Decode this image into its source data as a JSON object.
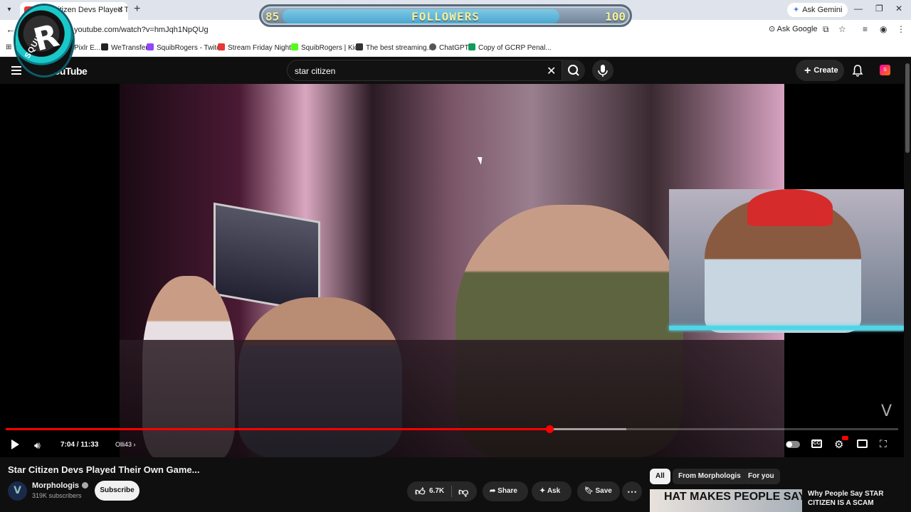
{
  "browser": {
    "tab_title": "Star Citizen Devs Played Their Own Game...",
    "ask_gemini": "Ask Gemini",
    "url": "youtube.com/watch?v=hmJqh1NpQUg",
    "ask_google": "Ask Google",
    "bookmarks": [
      {
        "label": "Pixlr E...",
        "color": "#1a73e8"
      },
      {
        "label": "WeTransfer",
        "color": "#ffffff"
      },
      {
        "label": "SquibRogers - Twitch",
        "color": "#9146ff"
      },
      {
        "label": "Stream Friday Night...",
        "color": "#e53935"
      },
      {
        "label": "SquibRogers | Kick",
        "color": "#53fc18"
      },
      {
        "label": "The best streaming...",
        "color": "#333333"
      },
      {
        "label": "ChatGPT",
        "color": "#555555"
      },
      {
        "label": "Copy of GCRP Penal...",
        "color": "#0f9d58"
      }
    ]
  },
  "overlay": {
    "followers_label": "FOLLOWERS",
    "current": "85",
    "goal": "100",
    "progress_fraction": 0.85,
    "logo_text": "SQUIB"
  },
  "youtube": {
    "logo": "YouTube",
    "search_value": "star citizen",
    "create_label": "Create",
    "avatar_initial": "S"
  },
  "player": {
    "time": "7:04 / 11:33",
    "chapter": "Olli43",
    "progress_fraction": 0.609,
    "buffer_fraction": 0.695
  },
  "video": {
    "title": "Star Citizen Devs Played Their Own Game...",
    "channel": "Morphologis",
    "channel_initial": "V",
    "subscribers": "319K subscribers",
    "subscribe_label": "Subscribe",
    "likes": "6.7K",
    "share_label": "Share",
    "ask_label": "Ask",
    "save_label": "Save"
  },
  "sidebar": {
    "chips": [
      "All",
      "From Morphologis",
      "For you"
    ],
    "rec_thumb_text": "HAT MAKES PEOPLE SAY",
    "rec_title": "Why People Say STAR CITIZEN IS A SCAM"
  },
  "colors": {
    "accent": "#ff0000",
    "background": "#0f0f0f",
    "overlay_text": "#f6ee9a"
  }
}
